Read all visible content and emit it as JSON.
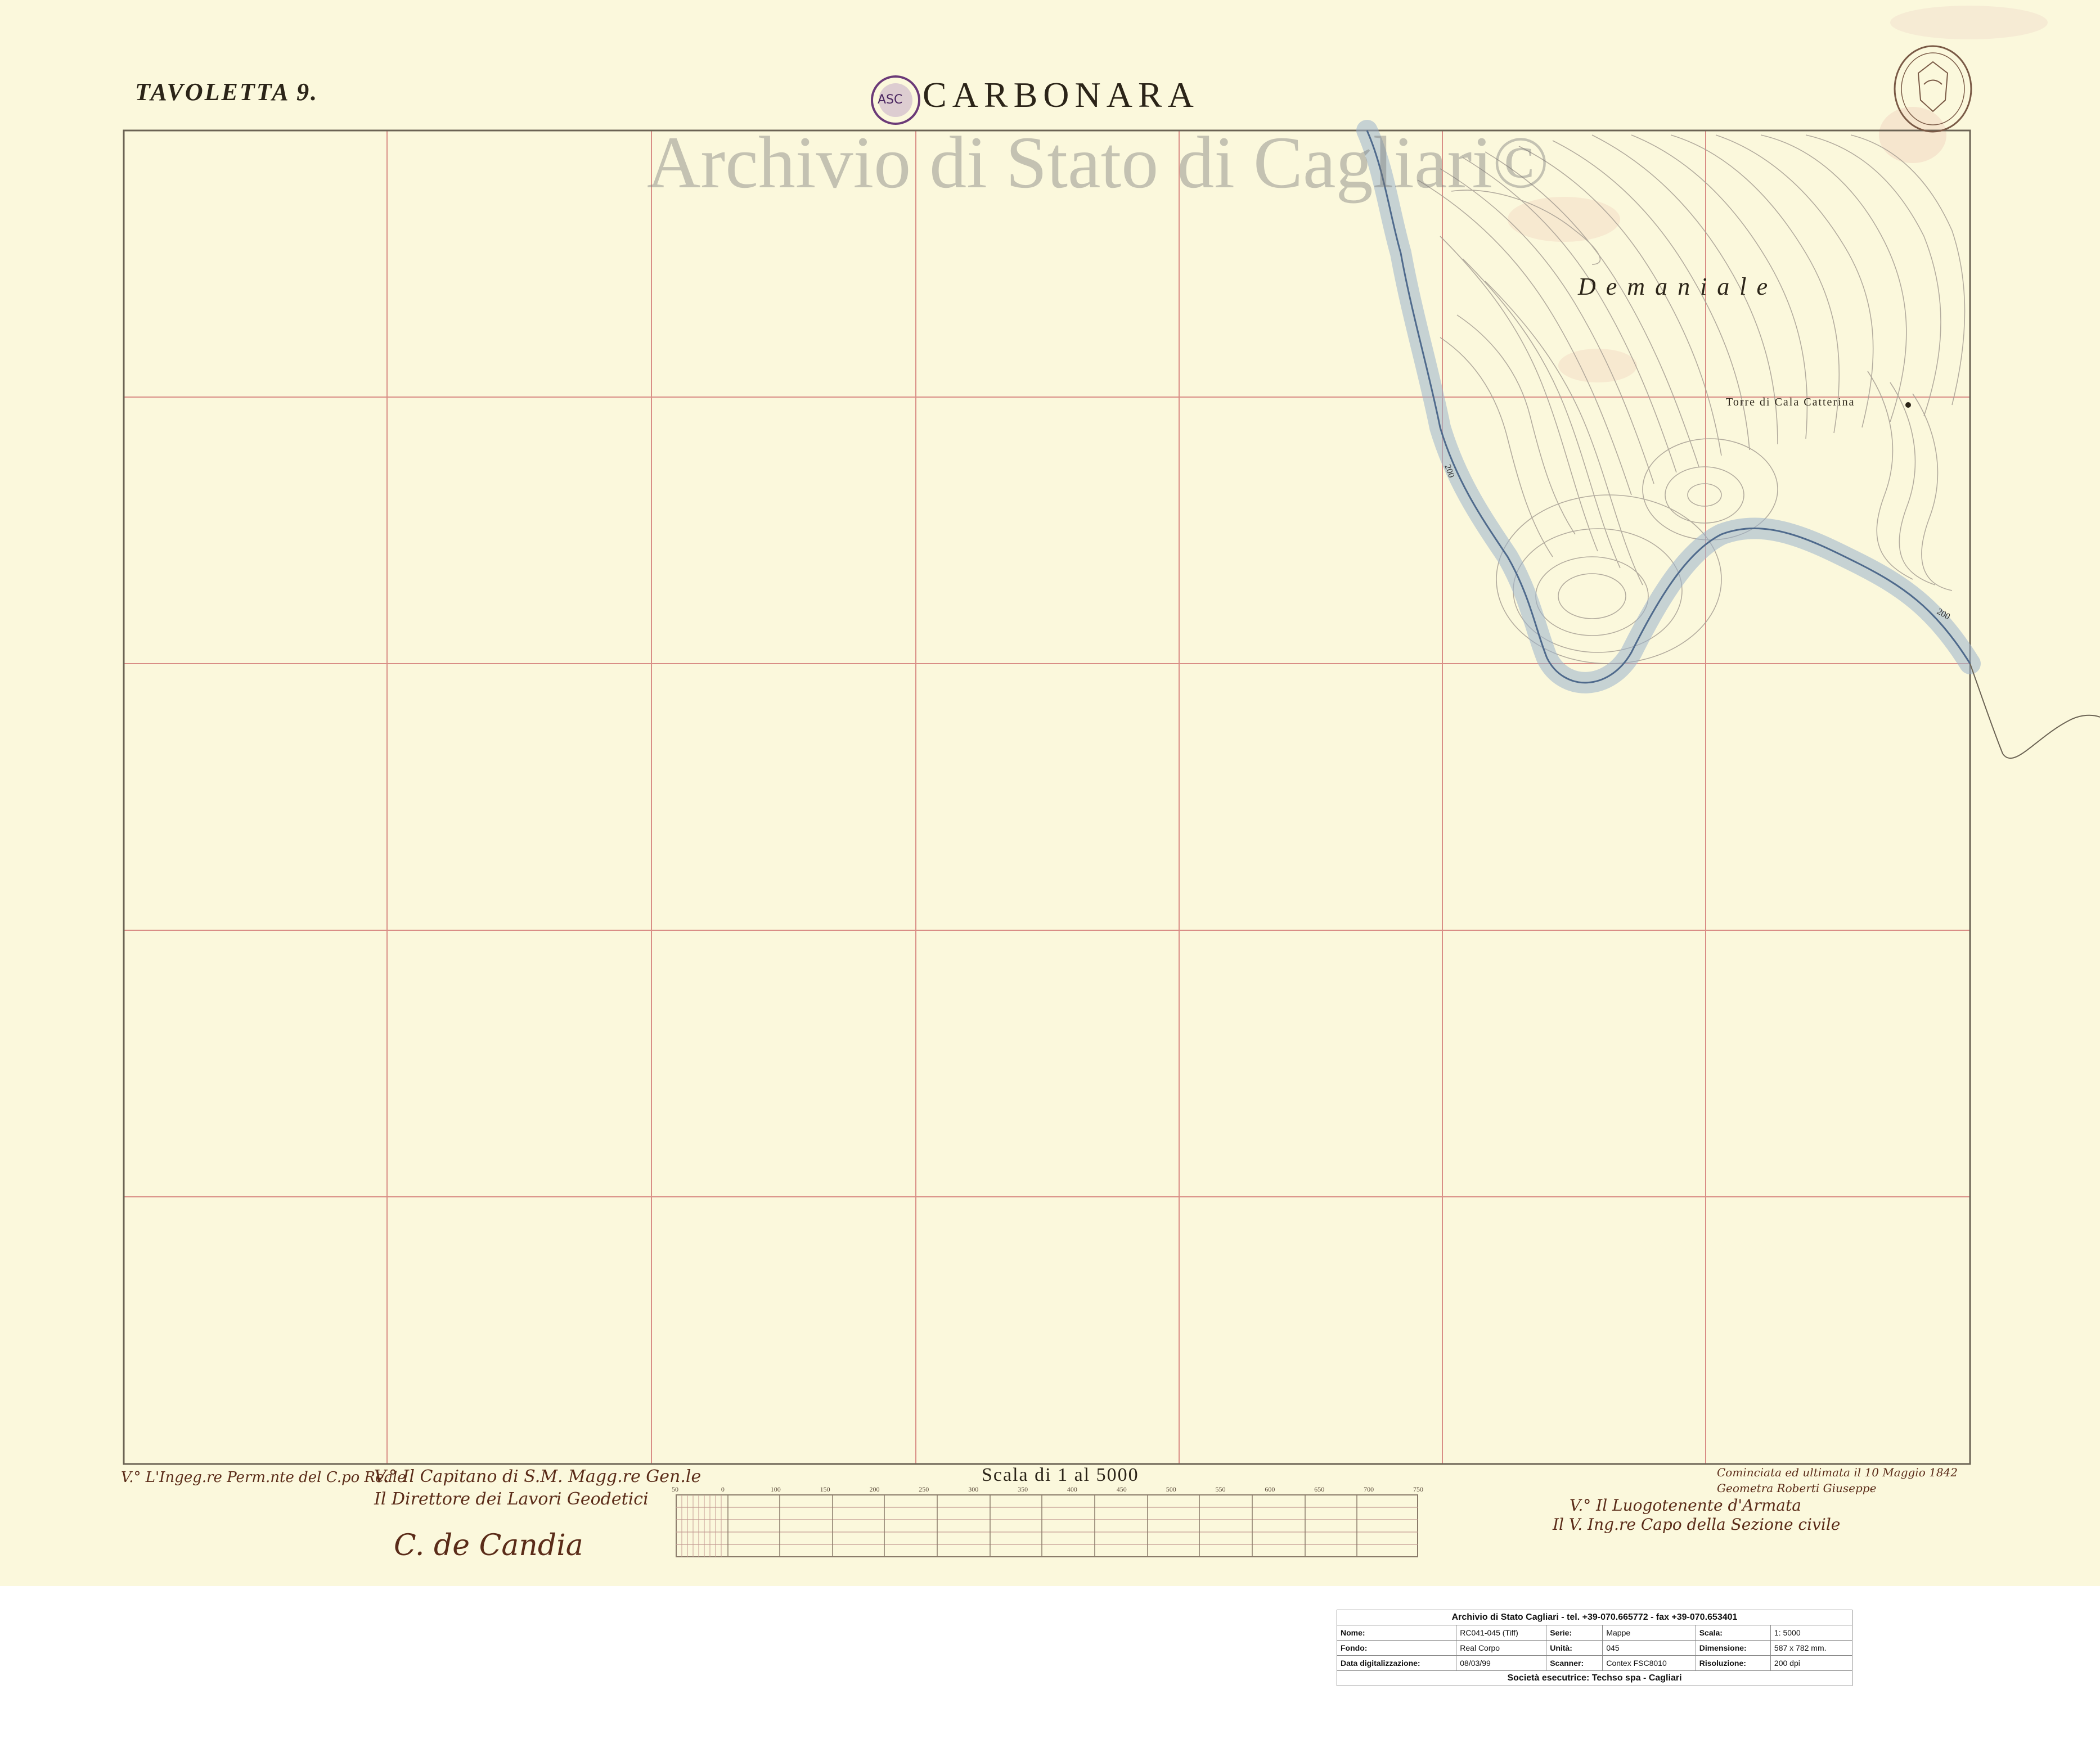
{
  "map": {
    "sheet_label": "TAVOLETTA 9.",
    "title": "CARBONARA",
    "watermark": "Archivio di Stato di Cagliari©",
    "place_names": [
      "Demaniale",
      "Torre di Cala Catterina"
    ],
    "contour_labels": [
      "200",
      "200"
    ],
    "scale_label": "Scala di 1 al 5000",
    "scale_ticks": [
      "50",
      "0",
      "100",
      "150",
      "200",
      "250",
      "300",
      "350",
      "400",
      "450",
      "500",
      "550",
      "600",
      "650",
      "700",
      "750"
    ],
    "signatures": [
      "V.° L'Ingeg.re Perm.nte del C.po Reale",
      "V.° Il Capitano di S.M. Magg.re Gen.le",
      "Il Direttore dei Lavori Geodetici",
      "C. de Candia",
      "V.° Il Luogotenente d'Armata",
      "Il V. Ing.re Capo della Sezione civile",
      "Cominciata ed ultimata il 10 Maggio 1842",
      "Geometra Roberti Giuseppe"
    ],
    "colors": {
      "paper": "#fbf8dc",
      "grid": "#d98e86",
      "frame": "#6b6354",
      "coast": "#7e98b6",
      "contour": "#9c9488",
      "watermark": "#787878",
      "stamp": "#6b3a78"
    }
  },
  "info_table": {
    "header": "Archivio di Stato Cagliari - tel. +39-070.665772 - fax +39-070.653401",
    "rows": [
      [
        "Nome:",
        "RC041-045 (Tiff)",
        "Serie:",
        "Mappe",
        "Scala:",
        "1: 5000"
      ],
      [
        "Fondo:",
        "Real Corpo",
        "Unità:",
        "045",
        "Dimensione:",
        "587 x 782 mm."
      ],
      [
        "Data digitalizzazione:",
        "08/03/99",
        "Scanner:",
        "Contex FSC8010",
        "Risoluzione:",
        "200 dpi"
      ]
    ],
    "footer": "Società esecutrice: Techso spa - Cagliari"
  }
}
